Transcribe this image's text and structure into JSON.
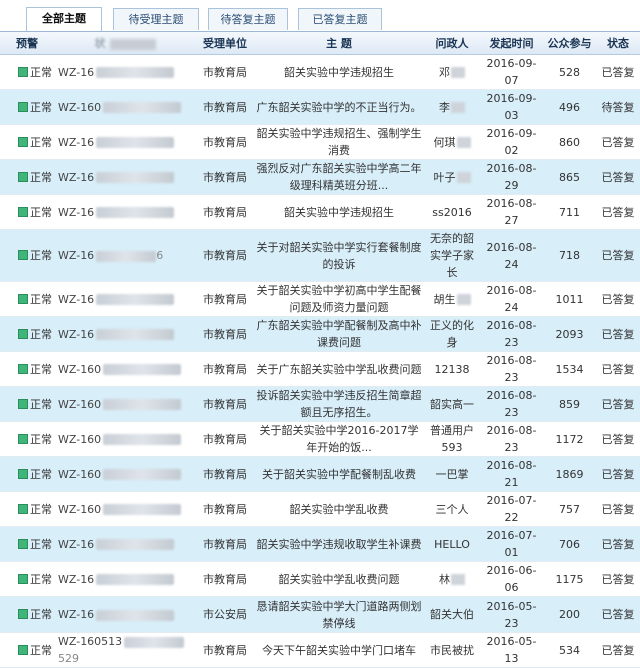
{
  "tabs": [
    {
      "label": "全部主题"
    },
    {
      "label": "待受理主题"
    },
    {
      "label": "待答复主题"
    },
    {
      "label": "已答复主题"
    }
  ],
  "columns": [
    "预警",
    "",
    "受理单位",
    "主 题",
    "问政人",
    "发起时间",
    "公众参与",
    "状态"
  ],
  "header_code_prefix": "状",
  "rows": [
    {
      "warn": "正常",
      "code": "WZ-16",
      "unit": "市教育局",
      "subject": "韶关实验中学违规招生",
      "person": "邓",
      "date": "2016-09-07",
      "count": "528",
      "status": "已答复"
    },
    {
      "warn": "正常",
      "code": "WZ-160",
      "unit": "市教育局",
      "subject": "广东韶关实验中学的不正当行为。",
      "person": "李",
      "date": "2016-09-03",
      "count": "496",
      "status": "待答复"
    },
    {
      "warn": "正常",
      "code": "WZ-16",
      "unit": "市教育局",
      "subject": "韶关实验中学违规招生、强制学生消费",
      "person": "何琪",
      "date": "2016-09-02",
      "count": "860",
      "status": "已答复"
    },
    {
      "warn": "正常",
      "code": "WZ-16",
      "unit": "市教育局",
      "subject": "强烈反对广东韶关实验中学高二年级理科精英班分班...",
      "person": "叶子",
      "date": "2016-08-29",
      "count": "865",
      "status": "已答复"
    },
    {
      "warn": "正常",
      "code": "WZ-16",
      "unit": "市教育局",
      "subject": "韶关实验中学违规招生",
      "person": "ss2016",
      "date": "2016-08-27",
      "count": "711",
      "status": "已答复"
    },
    {
      "warn": "正常",
      "code": "WZ-16",
      "code_tail": "6",
      "unit": "市教育局",
      "subject": "关于对韶关实验中学实行套餐制度的投诉",
      "person": "无奈的韶实学子家长",
      "date": "2016-08-24",
      "count": "718",
      "status": "已答复"
    },
    {
      "warn": "正常",
      "code": "WZ-16",
      "unit": "市教育局",
      "subject": "关于韶关实验中学初高中学生配餐问题及师资力量问题",
      "person": "胡生",
      "date": "2016-08-24",
      "count": "1011",
      "status": "已答复"
    },
    {
      "warn": "正常",
      "code": "WZ-16",
      "unit": "市教育局",
      "subject": "广东韶关实验中学配餐制及高中补课费问题",
      "person": "正义的化身",
      "date": "2016-08-23",
      "count": "2093",
      "status": "已答复"
    },
    {
      "warn": "正常",
      "code": "WZ-160",
      "unit": "市教育局",
      "subject": "关于广东韶关实验中学乱收费问题",
      "person": "12138",
      "date": "2016-08-23",
      "count": "1534",
      "status": "已答复"
    },
    {
      "warn": "正常",
      "code": "WZ-160",
      "unit": "市教育局",
      "subject": "投诉韶关实验中学违反招生简章超额且无序招生。",
      "person": "韶实高一",
      "date": "2016-08-23",
      "count": "859",
      "status": "已答复"
    },
    {
      "warn": "正常",
      "code": "WZ-160",
      "unit": "市教育局",
      "subject": "关于韶关实验中学2016-2017学年开始的饭...",
      "person": "普通用户593",
      "date": "2016-08-23",
      "count": "1172",
      "status": "已答复"
    },
    {
      "warn": "正常",
      "code": "WZ-160",
      "unit": "市教育局",
      "subject": "关于韶关实验中学配餐制乱收费",
      "person": "一巴掌",
      "date": "2016-08-21",
      "count": "1869",
      "status": "已答复"
    },
    {
      "warn": "正常",
      "code": "WZ-160",
      "unit": "市教育局",
      "subject": "韶关实验中学乱收费",
      "person": "三个人",
      "date": "2016-07-22",
      "count": "757",
      "status": "已答复"
    },
    {
      "warn": "正常",
      "code": "WZ-16",
      "unit": "市教育局",
      "subject": "韶关实验中学违规收取学生补课费",
      "person": "HELLO",
      "date": "2016-07-01",
      "count": "706",
      "status": "已答复"
    },
    {
      "warn": "正常",
      "code": "WZ-16",
      "unit": "市教育局",
      "subject": "韶关实验中学乱收费问题",
      "person": "林",
      "date": "2016-06-06",
      "count": "1175",
      "status": "已答复"
    },
    {
      "warn": "正常",
      "code": "WZ-16",
      "unit": "市公安局",
      "subject": "恳请韶关实验中学大门道路两侧划禁停线",
      "person": "韶关大伯",
      "date": "2016-05-23",
      "count": "200",
      "status": "已答复"
    },
    {
      "warn": "正常",
      "code": "WZ-160513",
      "code_tail": "529",
      "unit": "市教育局",
      "subject": "今天下午韶关实验中学门口堵车",
      "person": "市民被扰",
      "date": "2016-05-13",
      "count": "534",
      "status": "已答复"
    }
  ],
  "colors": {
    "even_row": "#d8eef9",
    "odd_row": "#ffffff",
    "header_bg": "#dde9f5",
    "status_icon": "#3fb57a"
  }
}
